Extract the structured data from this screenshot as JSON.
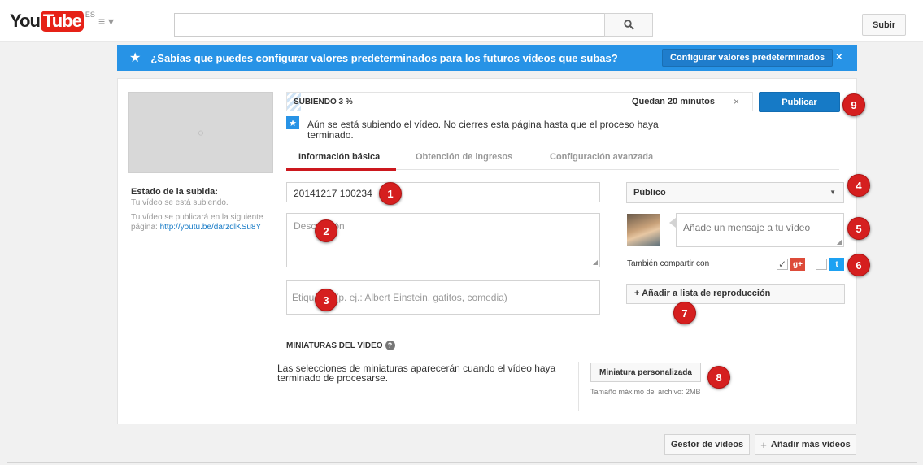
{
  "masthead": {
    "logo_you": "You",
    "logo_tube": "Tube",
    "logo_region": "ES",
    "guide_icon": "hamburger-icon",
    "search_icon": "search-icon",
    "upload_label": "Subir"
  },
  "banner": {
    "text": "¿Sabías que puedes configurar valores predeterminados para los futuros vídeos que subas?",
    "config_label": "Configurar valores predeterminados",
    "close_label": "×",
    "color": "#2793e6"
  },
  "sidebar": {
    "status_title": "Estado de la subida:",
    "status_sub": "Tu vídeo se está subiendo.",
    "publish_text": "Tu vídeo se publicará en la siguiente página: ",
    "publish_link": "http://youtu.be/darzdlKSu8Y"
  },
  "upload": {
    "progress_label": "SUBIENDO 3 %",
    "progress_percent": 3,
    "remaining": "Quedan 20 minutos",
    "close_label": "×",
    "publish_label": "Publicar",
    "notice": "Aún se está subiendo el vídeo. No cierres esta página hasta que el proceso haya terminado."
  },
  "tabs": [
    {
      "label": "Información básica",
      "active": true
    },
    {
      "label": "Obtención de ingresos",
      "active": false
    },
    {
      "label": "Configuración avanzada",
      "active": false
    }
  ],
  "form": {
    "title_value": "20141217 100234",
    "description_placeholder": "Descripción",
    "tags_placeholder": "Etiquetas (p. ej.: Albert Einstein, gatitos, comedia)",
    "privacy_value": "Público",
    "message_placeholder": "Añade un mensaje a tu vídeo",
    "share_label": "También compartir con",
    "share_gplus_checked": true,
    "share_twitter_checked": false,
    "playlist_label": "+ Añadir a lista de reproducción"
  },
  "thumbnails": {
    "heading": "MINIATURAS DEL VÍDEO",
    "help_glyph": "?",
    "text": "Las selecciones de miniaturas aparecerán cuando el vídeo haya terminado de procesarse.",
    "custom_label": "Miniatura personalizada",
    "max_size": "Tamaño máximo del archivo: 2MB"
  },
  "footer": {
    "video_manager_label": "Gestor de vídeos",
    "add_more_label": "Añadir más vídeos"
  },
  "callouts": [
    "1",
    "2",
    "3",
    "4",
    "5",
    "6",
    "7",
    "8",
    "9"
  ]
}
